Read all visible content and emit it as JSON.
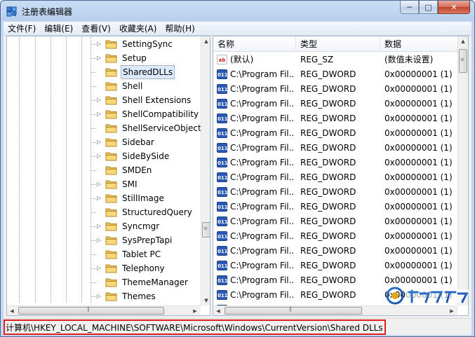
{
  "window": {
    "title": "注册表编辑器"
  },
  "title_buttons": {
    "minimize": "─",
    "maximize": "□",
    "close": "✕"
  },
  "menu": [
    {
      "label": "文件(F)"
    },
    {
      "label": "编辑(E)"
    },
    {
      "label": "查看(V)"
    },
    {
      "label": "收藏夹(A)"
    },
    {
      "label": "帮助(H)"
    }
  ],
  "tree": {
    "items": [
      {
        "label": "SettingSync",
        "expandable": true,
        "selected": false
      },
      {
        "label": "Setup",
        "expandable": true,
        "selected": false
      },
      {
        "label": "SharedDLLs",
        "expandable": false,
        "selected": true
      },
      {
        "label": "Shell",
        "expandable": false,
        "selected": false
      },
      {
        "label": "Shell Extensions",
        "expandable": true,
        "selected": false
      },
      {
        "label": "ShellCompatibility",
        "expandable": true,
        "selected": false
      },
      {
        "label": "ShellServiceObjectDelayLoad",
        "expandable": false,
        "selected": false
      },
      {
        "label": "Sidebar",
        "expandable": true,
        "selected": false
      },
      {
        "label": "SideBySide",
        "expandable": true,
        "selected": false
      },
      {
        "label": "SMDEn",
        "expandable": false,
        "selected": false
      },
      {
        "label": "SMI",
        "expandable": true,
        "selected": false
      },
      {
        "label": "StillImage",
        "expandable": true,
        "selected": false
      },
      {
        "label": "StructuredQuery",
        "expandable": false,
        "selected": false
      },
      {
        "label": "Syncmgr",
        "expandable": true,
        "selected": false
      },
      {
        "label": "SysPrepTapi",
        "expandable": true,
        "selected": false
      },
      {
        "label": "Tablet PC",
        "expandable": false,
        "selected": false
      },
      {
        "label": "Telephony",
        "expandable": true,
        "selected": false
      },
      {
        "label": "ThemeManager",
        "expandable": false,
        "selected": false
      },
      {
        "label": "Themes",
        "expandable": true,
        "selected": false
      }
    ]
  },
  "list": {
    "columns": [
      "名称",
      "类型",
      "数据"
    ],
    "rows": [
      {
        "icon": "string-value-icon",
        "badge": "ab",
        "name": "(默认)",
        "type": "REG_SZ",
        "data": "(数值未设置)"
      },
      {
        "icon": "dword-value-icon",
        "badge": "011",
        "name": "C:\\Program Fil...",
        "type": "REG_DWORD",
        "data": "0x00000001 (1)"
      },
      {
        "icon": "dword-value-icon",
        "badge": "011",
        "name": "C:\\Program Fil...",
        "type": "REG_DWORD",
        "data": "0x00000001 (1)"
      },
      {
        "icon": "dword-value-icon",
        "badge": "011",
        "name": "C:\\Program Fil...",
        "type": "REG_DWORD",
        "data": "0x00000001 (1)"
      },
      {
        "icon": "dword-value-icon",
        "badge": "011",
        "name": "C:\\Program Fil...",
        "type": "REG_DWORD",
        "data": "0x00000001 (1)"
      },
      {
        "icon": "dword-value-icon",
        "badge": "011",
        "name": "C:\\Program Fil...",
        "type": "REG_DWORD",
        "data": "0x00000001 (1)"
      },
      {
        "icon": "dword-value-icon",
        "badge": "011",
        "name": "C:\\Program Fil...",
        "type": "REG_DWORD",
        "data": "0x00000001 (1)"
      },
      {
        "icon": "dword-value-icon",
        "badge": "011",
        "name": "C:\\Program Fil...",
        "type": "REG_DWORD",
        "data": "0x00000001 (1)"
      },
      {
        "icon": "dword-value-icon",
        "badge": "011",
        "name": "C:\\Program Fil...",
        "type": "REG_DWORD",
        "data": "0x00000001 (1)"
      },
      {
        "icon": "dword-value-icon",
        "badge": "011",
        "name": "C:\\Program Fil...",
        "type": "REG_DWORD",
        "data": "0x00000001 (1)"
      },
      {
        "icon": "dword-value-icon",
        "badge": "011",
        "name": "C:\\Program Fil...",
        "type": "REG_DWORD",
        "data": "0x00000001 (1)"
      },
      {
        "icon": "dword-value-icon",
        "badge": "011",
        "name": "C:\\Program Fil...",
        "type": "REG_DWORD",
        "data": "0x00000001 (1)"
      },
      {
        "icon": "dword-value-icon",
        "badge": "011",
        "name": "C:\\Program Fil...",
        "type": "REG_DWORD",
        "data": "0x00000001 (1)"
      },
      {
        "icon": "dword-value-icon",
        "badge": "011",
        "name": "C:\\Program Fil...",
        "type": "REG_DWORD",
        "data": "0x00000001 (1)"
      },
      {
        "icon": "dword-value-icon",
        "badge": "011",
        "name": "C:\\Program Fil...",
        "type": "REG_DWORD",
        "data": "0x00000001 (1)"
      },
      {
        "icon": "dword-value-icon",
        "badge": "011",
        "name": "C:\\Program Fil...",
        "type": "REG_DWORD",
        "data": "0x00000001 (1)"
      },
      {
        "icon": "dword-value-icon",
        "badge": "011",
        "name": "C:\\Program Fil...",
        "type": "REG_DWORD",
        "data": "0x00000001 (1)"
      },
      {
        "icon": "dword-value-icon",
        "badge": "011",
        "name": "C:\\Program Fil...",
        "type": "REG_DWORD",
        "data": "0x00000001 (1)"
      }
    ]
  },
  "status": {
    "path": "计算机\\HKEY_LOCAL_MACHINE\\SOFTWARE\\Microsoft\\Windows\\CurrentVersion\\Shared DLLs"
  },
  "colors": {
    "highlight_border": "#e02020",
    "dword_icon": "#2a5ab6",
    "string_icon": "#c02020"
  }
}
